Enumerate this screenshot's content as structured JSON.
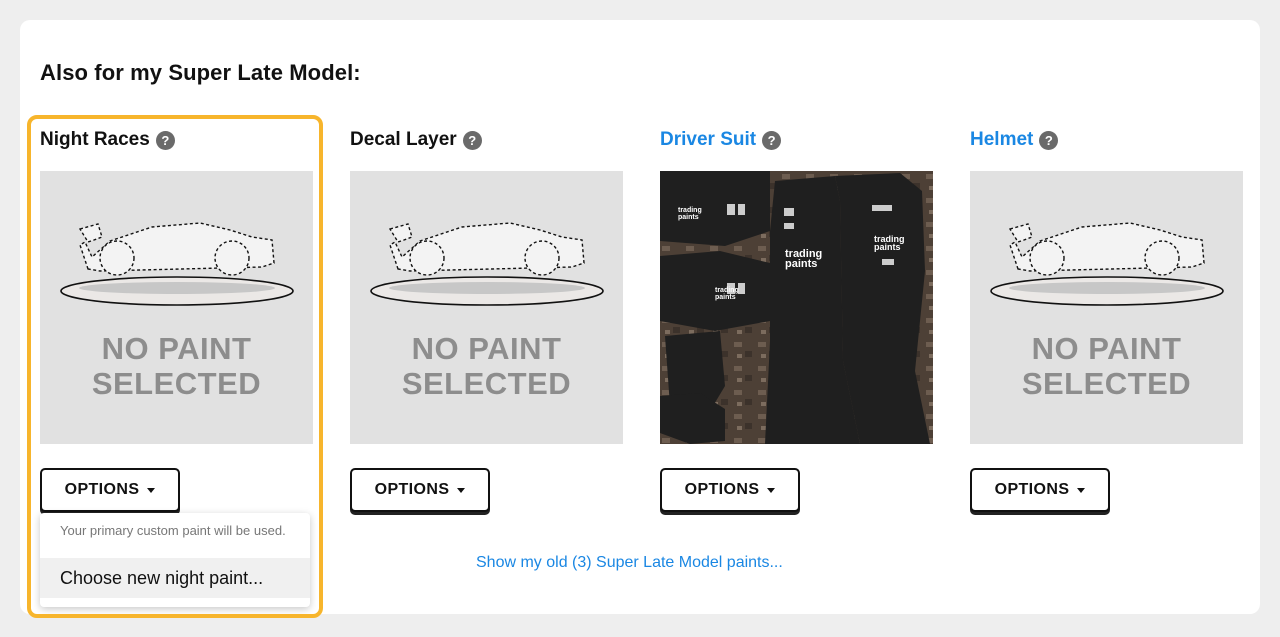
{
  "section": {
    "title": "Also for my Super Late Model:"
  },
  "columns": [
    {
      "label": "Night Races",
      "link": false,
      "help": "?",
      "preview": "no-paint",
      "no_paint_line1": "NO PAINT",
      "no_paint_line2": "SELECTED",
      "options_label": "OPTIONS",
      "selected": true
    },
    {
      "label": "Decal Layer",
      "link": false,
      "help": "?",
      "preview": "no-paint",
      "no_paint_line1": "NO PAINT",
      "no_paint_line2": "SELECTED",
      "options_label": "OPTIONS"
    },
    {
      "label": "Driver Suit",
      "link": true,
      "help": "?",
      "preview": "suit-paint",
      "options_label": "OPTIONS",
      "suit_texts": [
        "trading paints",
        "trading paints",
        "trading paints",
        "trading paints"
      ]
    },
    {
      "label": "Helmet",
      "link": true,
      "help": "?",
      "preview": "no-paint",
      "no_paint_line1": "NO PAINT",
      "no_paint_line2": "SELECTED",
      "options_label": "OPTIONS"
    }
  ],
  "dropdown": {
    "note": "Your primary custom paint will be used.",
    "item": "Choose new night paint..."
  },
  "show_old_link": "Show my old (3) Super Late Model paints...",
  "colors": {
    "highlight": "#f7b52c",
    "link": "#1a87e3",
    "preview_bg": "#e1e1e1",
    "no_paint_text": "#8d8d8d"
  }
}
